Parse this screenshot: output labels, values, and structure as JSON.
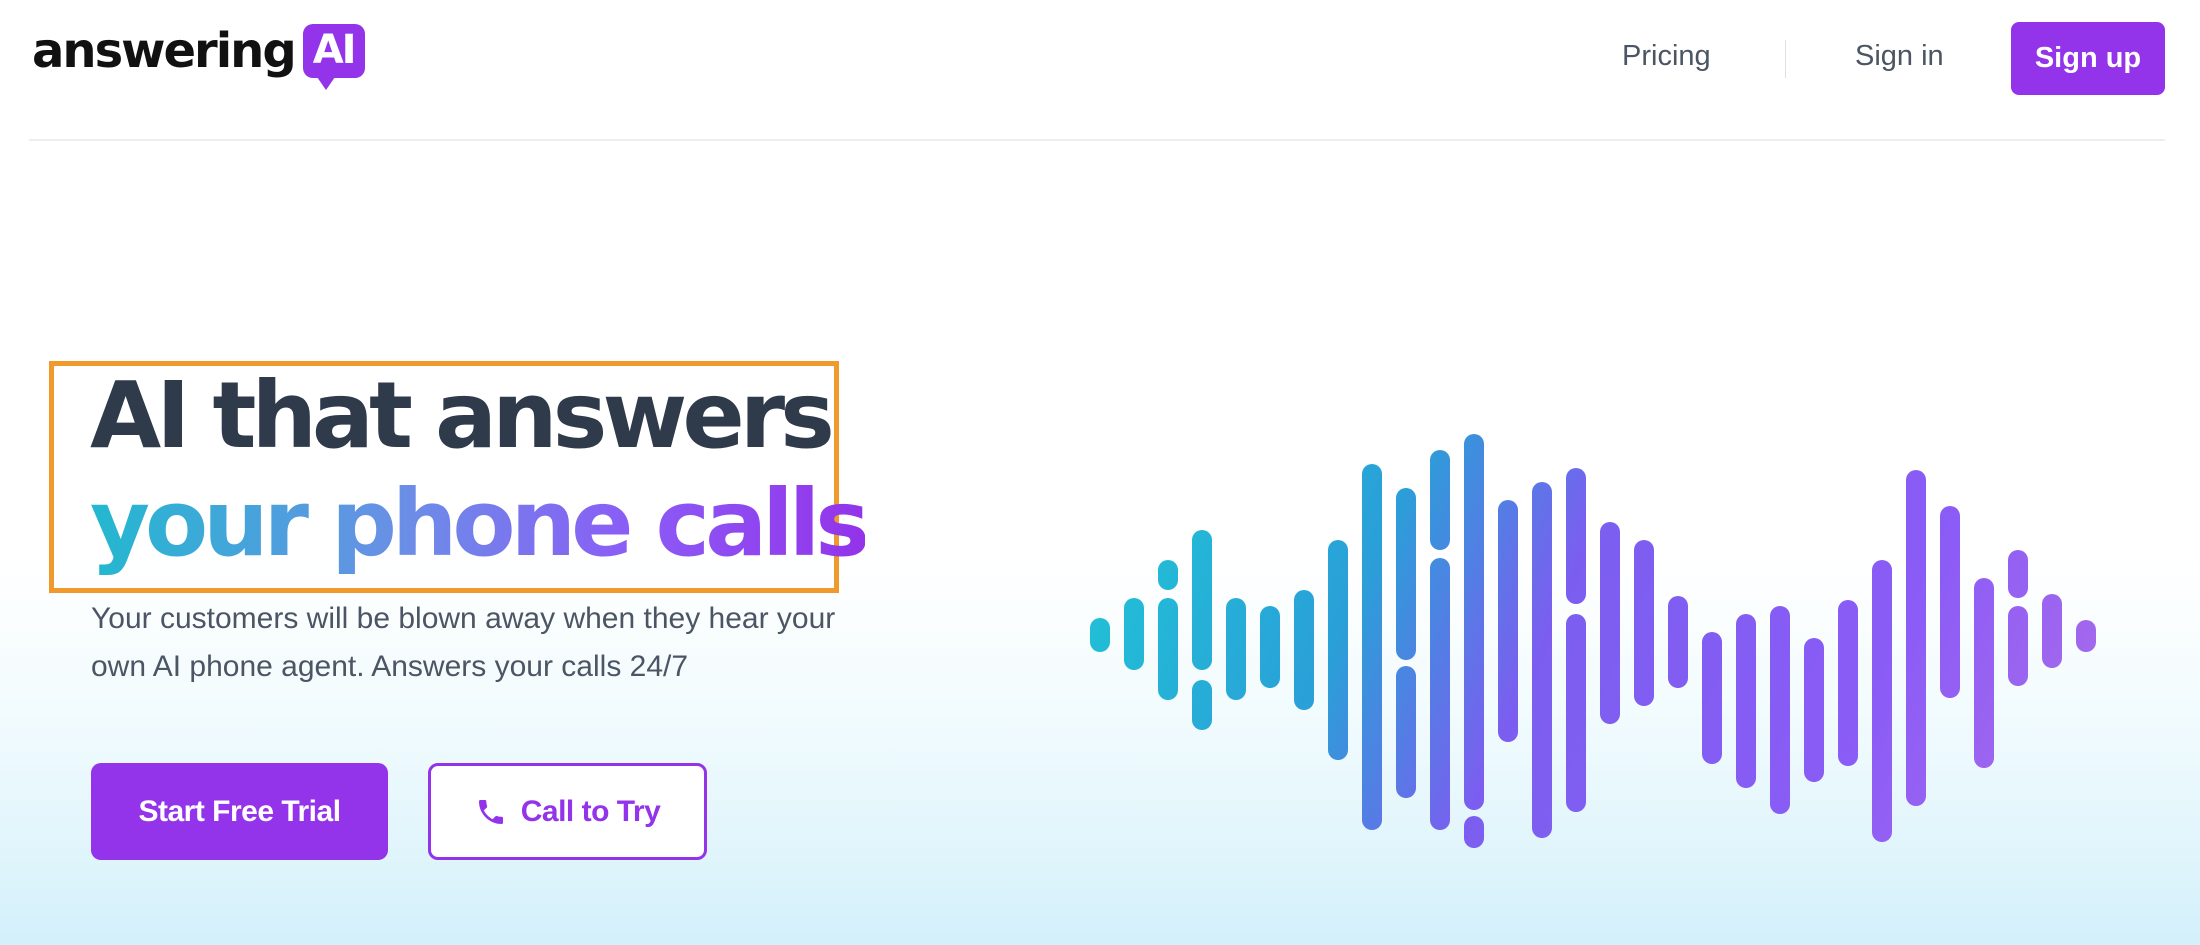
{
  "header": {
    "logo_word": "answering",
    "logo_badge": "AI",
    "nav": {
      "pricing": "Pricing",
      "sign_in": "Sign in",
      "sign_up": "Sign up"
    }
  },
  "hero": {
    "headline_line1": "AI that answers",
    "headline_line2": "your phone calls",
    "subtext": "Your customers will be blown away when they hear your own AI phone agent. Answers your calls 24/7",
    "cta_primary": "Start Free Trial",
    "cta_secondary": "Call to Try"
  },
  "icons": {
    "call_button": "phone-icon",
    "illustration": "sound-wave-graphic"
  },
  "colors": {
    "brand": "#9333ea",
    "headline_dark": "#2f3a4b",
    "gradient_start": "#22b8cf",
    "gradient_end": "#9333ea",
    "highlight_border": "#f09a2d"
  }
}
